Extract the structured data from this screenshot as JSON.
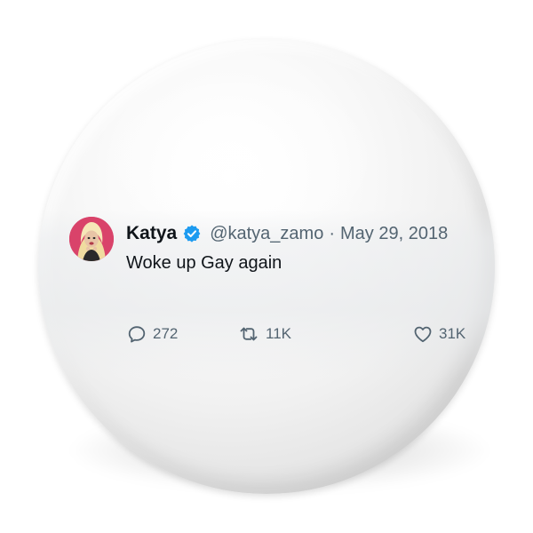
{
  "tweet": {
    "display_name": "Katya",
    "verified_icon": "verified-badge-icon",
    "handle": "@katya_zamo",
    "separator": "·",
    "date": "May 29, 2018",
    "text": "Woke up Gay again",
    "stats": {
      "replies": "272",
      "retweets": "11K",
      "likes": "31K"
    }
  },
  "colors": {
    "accent_blue": "#1d9bf0",
    "text_primary": "#0f1419",
    "text_secondary": "#536471",
    "avatar_background": "#d9436a"
  }
}
